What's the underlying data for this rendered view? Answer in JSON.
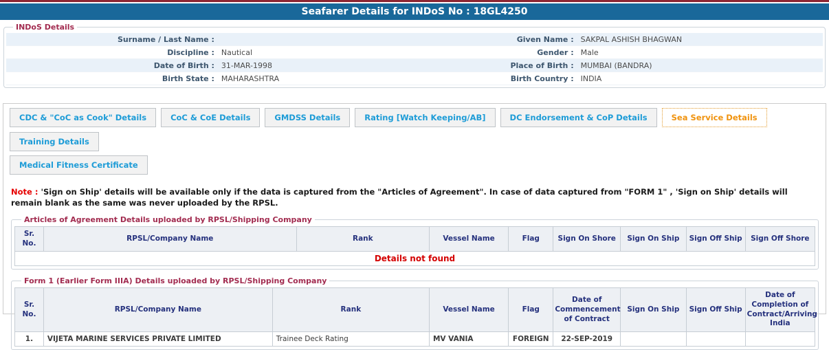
{
  "page": {
    "title": "Seafarer Details for INDoS No : 18GL4250"
  },
  "colors": {
    "header_bar": "#19689a",
    "top_line": "#8c2633",
    "legend_text": "#a22c50",
    "tab_text": "#1e9cd7",
    "active_tab_text": "#f0930f",
    "table_header_text": "#25317d",
    "note_prefix": "#e60000",
    "empty_message_text": "#d40000",
    "stripe_row": "#e9f1f9"
  },
  "indos_details": {
    "legend": "INDoS Details",
    "rows": [
      {
        "label_left": "Surname / Last Name :",
        "value_left": "",
        "label_right": "Given Name :",
        "value_right": "SAKPAL ASHISH BHAGWAN"
      },
      {
        "label_left": "Discipline :",
        "value_left": "Nautical",
        "label_right": "Gender :",
        "value_right": "Male"
      },
      {
        "label_left": "Date of Birth :",
        "value_left": "31-MAR-1998",
        "label_right": "Place of Birth :",
        "value_right": "MUMBAI (BANDRA)"
      },
      {
        "label_left": "Birth State :",
        "value_left": "MAHARASHTRA",
        "label_right": "Birth Country :",
        "value_right": "INDIA"
      }
    ]
  },
  "tabs": {
    "active": "Sea Service Details",
    "items": [
      {
        "label": "CDC & \"CoC as Cook\" Details",
        "row": 1,
        "active": false
      },
      {
        "label": "CoC & CoE Details",
        "row": 1,
        "active": false
      },
      {
        "label": "GMDSS Details",
        "row": 1,
        "active": false
      },
      {
        "label": "Rating [Watch Keeping/AB]",
        "row": 1,
        "active": false
      },
      {
        "label": "DC Endorsement & CoP Details",
        "row": 1,
        "active": false
      },
      {
        "label": "Sea Service Details",
        "row": 1,
        "active": true
      },
      {
        "label": "Training Details",
        "row": 1,
        "active": false
      },
      {
        "label": "Medical Fitness Certificate",
        "row": 2,
        "active": false
      }
    ]
  },
  "note": {
    "prefix": "Note :",
    "text": " 'Sign on Ship' details will be available only if the data is captured from the \"Articles of Agreement\". In case of data captured from \"FORM 1\" , 'Sign on Ship' details will remain blank as the same was never uploaded by the RPSL."
  },
  "articles_table": {
    "legend": "Articles of Agreement Details uploaded by RPSL/Shipping Company",
    "headers": [
      "Sr. No.",
      "RPSL/Company Name",
      "Rank",
      "Vessel Name",
      "Flag",
      "Sign On Shore",
      "Sign On Ship",
      "Sign Off Ship",
      "Sign Off Shore"
    ],
    "empty_message": "Details not found"
  },
  "form1_table": {
    "legend": "Form 1 (Earlier Form IIIA) Details uploaded by RPSL/Shipping Company",
    "headers": [
      "Sr. No.",
      "RPSL/Company Name",
      "Rank",
      "Vessel Name",
      "Flag",
      "Date of Commencement of Contract",
      "Sign On Ship",
      "Sign Off Ship",
      "Date of Completion of Contract/Arriving India"
    ],
    "rows": [
      [
        "1.",
        "VIJETA MARINE SERVICES PRIVATE LIMITED",
        "Trainee Deck Rating",
        "MV VANIA",
        "FOREIGN",
        "22-SEP-2019",
        "",
        "",
        ""
      ]
    ]
  }
}
